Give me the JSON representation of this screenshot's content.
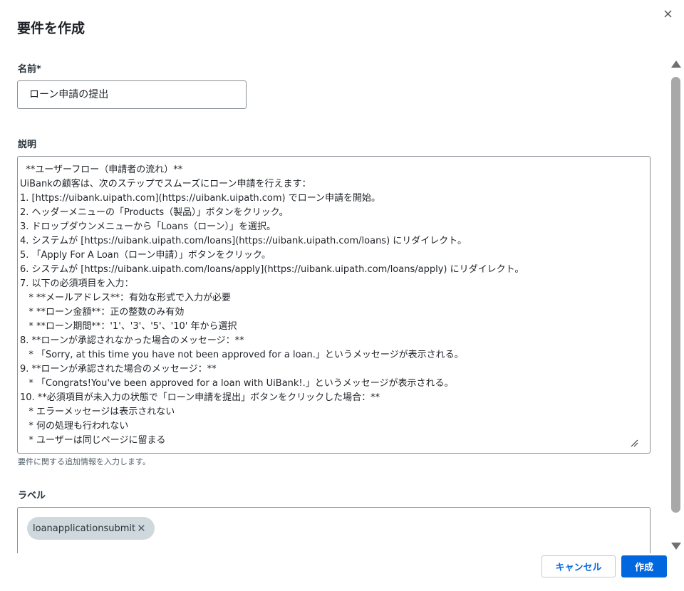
{
  "dialog": {
    "title": "要件を作成"
  },
  "form": {
    "name_label": "名前*",
    "name_value": "ローン申請の提出",
    "description_label": "説明",
    "description_value": "  **ユーザーフロー（申請者の流れ）**\nUiBankの顧客は、次のステップでスムーズにローン申請を行えます：\n1. [https://uibank.uipath.com](https://uibank.uipath.com) でローン申請を開始。\n2. ヘッダーメニューの「Products（製品）」ボタンをクリック。\n3. ドロップダウンメニューから「Loans（ローン）」を選択。\n4. システムが [https://uibank.uipath.com/loans](https://uibank.uipath.com/loans) にリダイレクト。\n5. 「Apply For A Loan（ローン申請）」ボタンをクリック。\n6. システムが [https://uibank.uipath.com/loans/apply](https://uibank.uipath.com/loans/apply) にリダイレクト。\n7. 以下の必須項目を入力：\n   * **メールアドレス**：有効な形式で入力が必要\n   * **ローン金額**：正の整数のみ有効\n   * **ローン期間**：'1'、'3'、'5'、'10' 年から選択\n8. **ローンが承認されなかった場合のメッセージ：**\n   * 「Sorry, at this time you have not been approved for a loan.」というメッセージが表示される。\n9. **ローンが承認された場合のメッセージ：**\n   * 「Congrats!You've been approved for a loan with UiBank!.」というメッセージが表示される。\n10. **必須項目が未入力の状態で「ローン申請を提出」ボタンをクリックした場合：**\n   * エラーメッセージは表示されない\n   * 何の処理も行われない\n   * ユーザーは同じページに留まる",
    "description_helper": "要件に関する追加情報を入力します。",
    "labels_label": "ラベル",
    "labels": [
      "loanapplicationsubmit"
    ]
  },
  "actions": {
    "cancel_label": "キャンセル",
    "create_label": "作成"
  },
  "icons": {
    "close": "close-icon",
    "chip_remove": "close-icon",
    "resize": "resize-grip-icon",
    "scroll_up": "arrow-up-icon",
    "scroll_down": "arrow-down-icon"
  },
  "colors": {
    "primary": "#0067df",
    "chip_bg": "#cfd8dd",
    "border": "#8a8f94"
  }
}
